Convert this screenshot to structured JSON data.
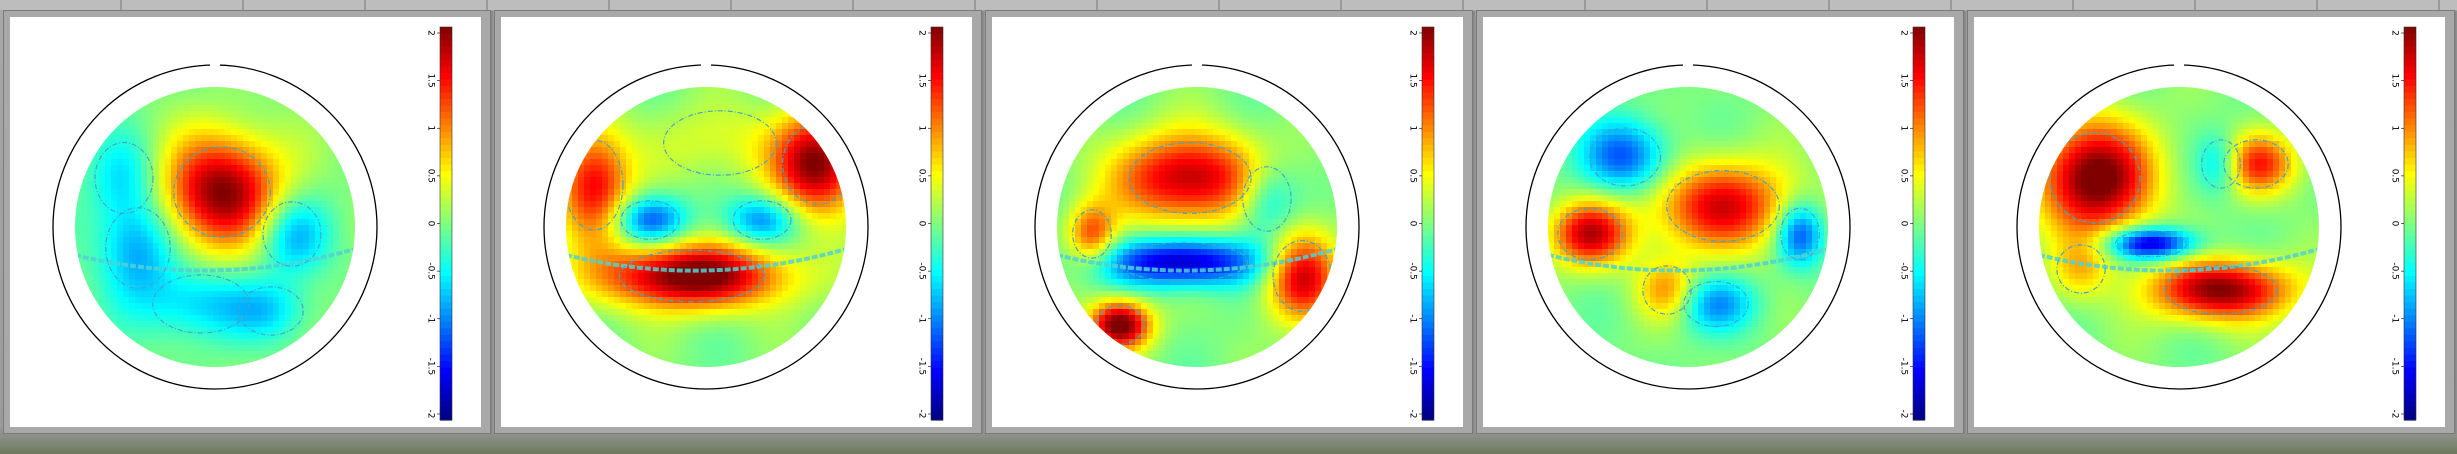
{
  "chart_data": [
    {
      "type": "heatmap",
      "colorbar": {
        "ticks": [
          "2",
          "1.5",
          "1",
          "0.5",
          "0",
          "-0.5",
          "-1",
          "-1.5",
          "-2"
        ],
        "range": [
          -2,
          2
        ]
      },
      "blobs": [
        {
          "u": 0.05,
          "v": -0.25,
          "su": 0.3,
          "sv": 0.28,
          "a": 2.0
        },
        {
          "u": 0.55,
          "v": 0.05,
          "su": 0.18,
          "sv": 0.2,
          "a": -0.9
        },
        {
          "u": -0.55,
          "v": 0.15,
          "su": 0.2,
          "sv": 0.25,
          "a": -0.9
        },
        {
          "u": -0.1,
          "v": 0.55,
          "su": 0.3,
          "sv": 0.18,
          "a": -0.7
        },
        {
          "u": -0.65,
          "v": -0.35,
          "su": 0.18,
          "sv": 0.22,
          "a": -0.6
        },
        {
          "u": 0.4,
          "v": 0.6,
          "su": 0.2,
          "sv": 0.15,
          "a": -0.5
        }
      ]
    },
    {
      "type": "heatmap",
      "colorbar": {
        "ticks": [
          "2",
          "1.5",
          "1",
          "0.5",
          "0",
          "-0.5",
          "-1",
          "-1.5",
          "-2"
        ],
        "range": [
          -2,
          2
        ]
      },
      "blobs": [
        {
          "u": -0.1,
          "v": 0.35,
          "su": 0.45,
          "sv": 0.16,
          "a": 2.2
        },
        {
          "u": 0.8,
          "v": -0.45,
          "su": 0.22,
          "sv": 0.25,
          "a": 2.0
        },
        {
          "u": -0.8,
          "v": -0.3,
          "su": 0.18,
          "sv": 0.28,
          "a": 1.6
        },
        {
          "u": -0.4,
          "v": -0.05,
          "su": 0.18,
          "sv": 0.12,
          "a": -1.2
        },
        {
          "u": 0.4,
          "v": -0.05,
          "su": 0.18,
          "sv": 0.12,
          "a": -1.0
        },
        {
          "u": 0.1,
          "v": -0.6,
          "su": 0.35,
          "sv": 0.2,
          "a": 0.4
        }
      ]
    },
    {
      "type": "heatmap",
      "colorbar": {
        "ticks": [
          "2",
          "1.5",
          "1",
          "0.5",
          "0",
          "-0.5",
          "-1",
          "-1.5",
          "-2"
        ],
        "range": [
          -2,
          2
        ]
      },
      "blobs": [
        {
          "u": -0.05,
          "v": -0.35,
          "su": 0.38,
          "sv": 0.22,
          "a": 1.8
        },
        {
          "u": -0.1,
          "v": 0.25,
          "su": 0.4,
          "sv": 0.12,
          "a": -1.8
        },
        {
          "u": -0.55,
          "v": 0.7,
          "su": 0.15,
          "sv": 0.12,
          "a": 2.2
        },
        {
          "u": 0.75,
          "v": 0.35,
          "su": 0.18,
          "sv": 0.22,
          "a": 1.7
        },
        {
          "u": -0.75,
          "v": 0.05,
          "su": 0.12,
          "sv": 0.15,
          "a": 1.2
        },
        {
          "u": 0.5,
          "v": -0.2,
          "su": 0.15,
          "sv": 0.2,
          "a": -0.8
        }
      ]
    },
    {
      "type": "heatmap",
      "colorbar": {
        "ticks": [
          "2",
          "1.5",
          "1",
          "0.5",
          "0",
          "-0.5",
          "-1",
          "-1.5",
          "-2"
        ],
        "range": [
          -2,
          2
        ]
      },
      "blobs": [
        {
          "u": 0.25,
          "v": -0.15,
          "su": 0.35,
          "sv": 0.22,
          "a": 1.6
        },
        {
          "u": -0.7,
          "v": 0.05,
          "su": 0.2,
          "sv": 0.16,
          "a": 1.7
        },
        {
          "u": -0.45,
          "v": -0.5,
          "su": 0.22,
          "sv": 0.18,
          "a": -1.2
        },
        {
          "u": 0.8,
          "v": 0.05,
          "su": 0.12,
          "sv": 0.16,
          "a": -1.3
        },
        {
          "u": 0.2,
          "v": 0.55,
          "su": 0.2,
          "sv": 0.14,
          "a": -0.9
        },
        {
          "u": -0.15,
          "v": 0.45,
          "su": 0.15,
          "sv": 0.15,
          "a": 0.9
        }
      ]
    },
    {
      "type": "heatmap",
      "colorbar": {
        "ticks": [
          "2",
          "1.5",
          "1",
          "0.5",
          "0",
          "-0.5",
          "-1",
          "-1.5",
          "-2"
        ],
        "range": [
          -2,
          2
        ]
      },
      "blobs": [
        {
          "u": -0.6,
          "v": -0.35,
          "su": 0.28,
          "sv": 0.28,
          "a": 2.2
        },
        {
          "u": 0.55,
          "v": -0.45,
          "su": 0.2,
          "sv": 0.15,
          "a": 1.4
        },
        {
          "u": 0.3,
          "v": 0.45,
          "su": 0.35,
          "sv": 0.15,
          "a": 2.0
        },
        {
          "u": -0.2,
          "v": 0.12,
          "su": 0.22,
          "sv": 0.08,
          "a": -1.8
        },
        {
          "u": 0.3,
          "v": -0.45,
          "su": 0.12,
          "sv": 0.15,
          "a": -0.9
        },
        {
          "u": -0.7,
          "v": 0.3,
          "su": 0.15,
          "sv": 0.15,
          "a": 0.6
        }
      ]
    }
  ]
}
